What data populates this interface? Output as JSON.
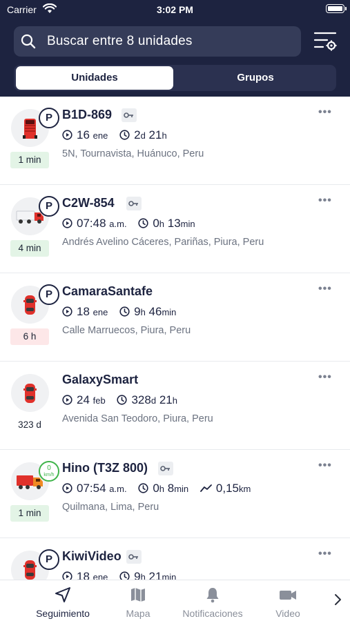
{
  "status_bar": {
    "carrier": "Carrier",
    "time": "3:02 PM"
  },
  "search": {
    "placeholder": "Buscar entre 8 unidades"
  },
  "tabs": [
    {
      "label": "Unidades",
      "active": true
    },
    {
      "label": "Grupos",
      "active": false
    }
  ],
  "units": [
    {
      "name": "B1D-869",
      "has_key": true,
      "status_badge": "P",
      "vehicle_icon": "truck-red-icon",
      "vehicle_color": "#e0312b",
      "age": "1 min",
      "age_style": "green",
      "date": "16",
      "date_unit": "ene",
      "duration_a": "2",
      "duration_a_unit": "d",
      "duration_b": "21",
      "duration_b_unit": "h",
      "address": "5N, Tournavista, Huánuco, Peru"
    },
    {
      "name": "C2W-854",
      "has_key": true,
      "status_badge": "P",
      "vehicle_icon": "semi-truck-icon",
      "vehicle_color": "#e0312b",
      "age": "4 min",
      "age_style": "green",
      "date": "07:48",
      "date_unit": "a.m.",
      "duration_a": "0",
      "duration_a_unit": "h",
      "duration_b": "13",
      "duration_b_unit": "min",
      "address": "Andrés Avelino Cáceres, Pariñas, Piura, Peru"
    },
    {
      "name": "CamaraSantafe",
      "has_key": false,
      "status_badge": "P",
      "vehicle_icon": "car-red-icon",
      "vehicle_color": "#e0312b",
      "age": "6 h",
      "age_style": "red",
      "date": "18",
      "date_unit": "ene",
      "duration_a": "9",
      "duration_a_unit": "h",
      "duration_b": "46",
      "duration_b_unit": "min",
      "address": "Calle Marruecos, Piura, Peru"
    },
    {
      "name": "GalaxySmart",
      "has_key": false,
      "status_badge": "",
      "vehicle_icon": "car-red-icon",
      "vehicle_color": "#e0312b",
      "age": "323 d",
      "age_style": "none",
      "date": "24",
      "date_unit": "feb",
      "duration_a": "328",
      "duration_a_unit": "d",
      "duration_b": "21",
      "duration_b_unit": "h",
      "address": "Avenida San Teodoro, Piura, Peru"
    },
    {
      "name": "Hino (T3Z 800)",
      "has_key": true,
      "status_badge": "speed",
      "speed_value": "0",
      "speed_unit": "km/h",
      "vehicle_icon": "truck-orange-icon",
      "vehicle_color": "#f08a24",
      "age": "1 min",
      "age_style": "green",
      "date": "07:54",
      "date_unit": "a.m.",
      "duration_a": "0",
      "duration_a_unit": "h",
      "duration_b": "8",
      "duration_b_unit": "min",
      "distance": "0,15",
      "distance_unit": "km",
      "address": "Quilmana, Lima, Peru"
    },
    {
      "name": "KiwiVideo",
      "has_key": true,
      "status_badge": "P",
      "vehicle_icon": "car-red-icon",
      "vehicle_color": "#e0312b",
      "age": "",
      "age_style": "none",
      "date": "18",
      "date_unit": "ene",
      "duration_a": "9",
      "duration_a_unit": "h",
      "duration_b": "21",
      "duration_b_unit": "min",
      "address": ""
    }
  ],
  "bottom_nav": [
    {
      "label": "Seguimiento",
      "icon": "navigation-arrow-icon",
      "active": true
    },
    {
      "label": "Mapa",
      "icon": "map-icon",
      "active": false
    },
    {
      "label": "Notificaciones",
      "icon": "bell-icon",
      "active": false
    },
    {
      "label": "Video",
      "icon": "video-camera-icon",
      "active": false
    }
  ],
  "colors": {
    "header": "#1d2340",
    "accent_green": "#3fb44a",
    "age_green_bg": "#e3f4e6",
    "age_red_bg": "#fde7e8"
  }
}
